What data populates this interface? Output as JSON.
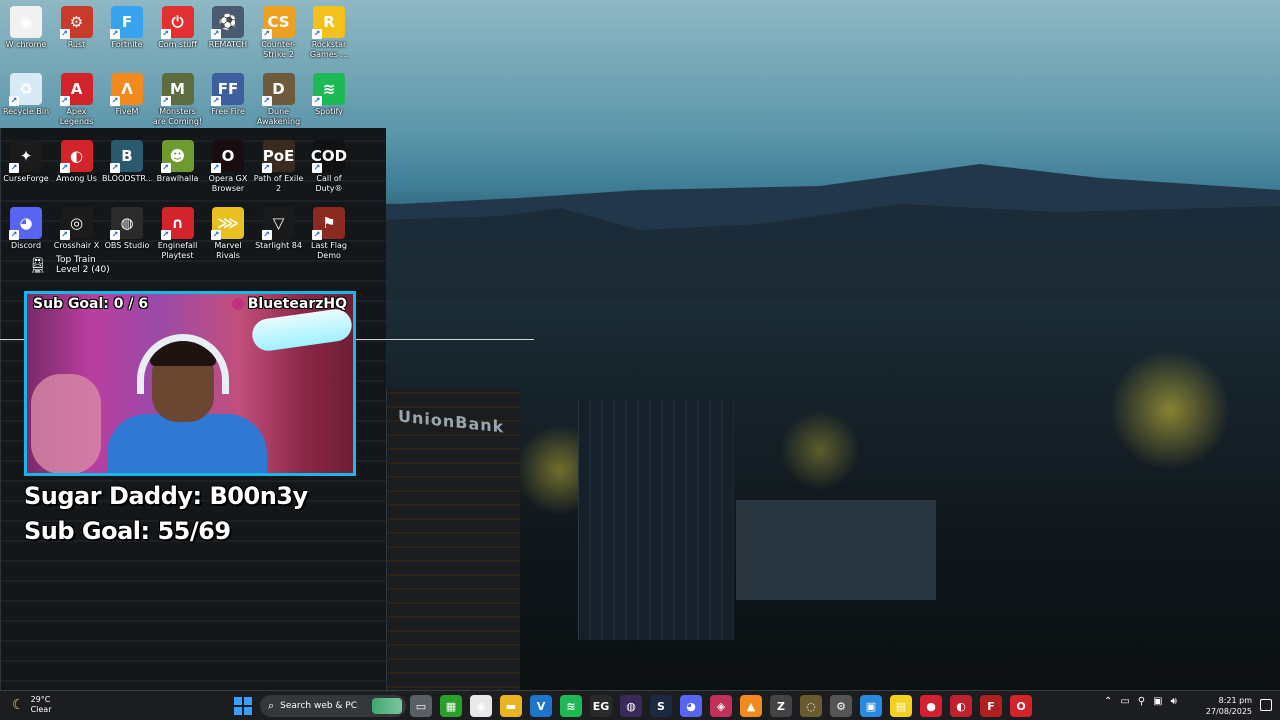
{
  "desktop": {
    "icons": [
      {
        "label": "W chrome",
        "icon": "chrome-icon",
        "color": "#f1f1f1",
        "glyph": "◉"
      },
      {
        "label": "Rust",
        "icon": "rust-icon",
        "color": "#c83b2a",
        "glyph": "⚙"
      },
      {
        "label": "Fortnite",
        "icon": "fortnite-icon",
        "color": "#38a4f0",
        "glyph": "F"
      },
      {
        "label": "Com stuff",
        "icon": "power-icon",
        "color": "#e23030",
        "glyph": "⏻"
      },
      {
        "label": "REMATCH",
        "icon": "rematch-icon",
        "color": "#4a5a70",
        "glyph": "⚽"
      },
      {
        "label": "Counter-Strike 2",
        "icon": "counter-strike-icon",
        "color": "#f0a020",
        "glyph": "CS"
      },
      {
        "label": "Rockstar Games ...",
        "icon": "rockstar-icon",
        "color": "#f4c01a",
        "glyph": "R"
      },
      {
        "label": "Recycle Bin",
        "icon": "recycle-bin-icon",
        "color": "#d9eaf7",
        "glyph": "♻"
      },
      {
        "label": "Apex Legends",
        "icon": "apex-legends-icon",
        "color": "#d3242b",
        "glyph": "A"
      },
      {
        "label": "FiveM",
        "icon": "fivem-icon",
        "color": "#f38a1e",
        "glyph": "Λ"
      },
      {
        "label": "Monsters are Coming! R...",
        "icon": "monsters-icon",
        "color": "#5d6d3f",
        "glyph": "M"
      },
      {
        "label": "Free Fire",
        "icon": "free-fire-icon",
        "color": "#3d5fa0",
        "glyph": "FF"
      },
      {
        "label": "Dune Awakening",
        "icon": "dune-icon",
        "color": "#6e5a3c",
        "glyph": "D"
      },
      {
        "label": "Spotify",
        "icon": "spotify-icon",
        "color": "#1db954",
        "glyph": "≋"
      },
      {
        "label": "CurseForge",
        "icon": "curseforge-icon",
        "color": "#1b1b1b",
        "glyph": "✦"
      },
      {
        "label": "Among Us",
        "icon": "among-us-icon",
        "color": "#d3242b",
        "glyph": "◐"
      },
      {
        "label": "BLOODSTR...",
        "icon": "bloodstrike-icon",
        "color": "#2b5a6e",
        "glyph": "B"
      },
      {
        "label": "Brawlhalla",
        "icon": "brawlhalla-icon",
        "color": "#6e9a30",
        "glyph": "☻"
      },
      {
        "label": "Opera GX Browser",
        "icon": "opera-gx-icon",
        "color": "#1a0d10",
        "glyph": "O"
      },
      {
        "label": "Path of Exile 2",
        "icon": "path-of-exile-icon",
        "color": "#3a2a20",
        "glyph": "PoE"
      },
      {
        "label": "Call of Duty®",
        "icon": "call-of-duty-icon",
        "color": "#111111",
        "glyph": "COD"
      },
      {
        "label": "Discord",
        "icon": "discord-icon",
        "color": "#5865f2",
        "glyph": "◕"
      },
      {
        "label": "Crosshair X",
        "icon": "crosshair-icon",
        "color": "#1b1b1b",
        "glyph": "◎"
      },
      {
        "label": "OBS Studio",
        "icon": "obs-icon",
        "color": "#2b2b2b",
        "glyph": "◍"
      },
      {
        "label": "Enginefall Playtest",
        "icon": "enginefall-icon",
        "color": "#d3242b",
        "glyph": "∩"
      },
      {
        "label": "Marvel Rivals",
        "icon": "marvel-rivals-icon",
        "color": "#e8c020",
        "glyph": "⋙"
      },
      {
        "label": "Starlight 84",
        "icon": "starlight-icon",
        "color": "#1a1a1a",
        "glyph": "▽"
      },
      {
        "label": "Last Flag Demo",
        "icon": "last-flag-icon",
        "color": "#8a2a20",
        "glyph": "⚑"
      }
    ]
  },
  "widget": {
    "top_train_title": "Top Train",
    "top_train_level": "Level 2  (40)"
  },
  "stream": {
    "cam_goal": "Sub Goal:  0 / 6",
    "cam_handle": "BluetearzHQ",
    "overlay_line1": "Sugar Daddy: B00n3y",
    "overlay_line2": "Sub Goal: 55/69"
  },
  "wallpaper": {
    "building_sign": "UnionBank"
  },
  "taskbar": {
    "weather_temp": "29°C",
    "weather_desc": "Clear",
    "search_placeholder": "Search web & PC",
    "apps": [
      {
        "icon": "file-explorer-icon",
        "color": "#5a5f66",
        "glyph": "▭"
      },
      {
        "icon": "xbox-app-icon",
        "color": "#2aa02a",
        "glyph": "▦"
      },
      {
        "icon": "chrome-taskbar-icon",
        "color": "#e8e8e8",
        "glyph": "◉"
      },
      {
        "icon": "folder-icon",
        "color": "#e8b422",
        "glyph": "▬"
      },
      {
        "icon": "vscode-icon",
        "color": "#1d74c9",
        "glyph": "V"
      },
      {
        "icon": "spotify-taskbar-icon",
        "color": "#1db954",
        "glyph": "≋"
      },
      {
        "icon": "epic-games-icon",
        "color": "#2a2a2a",
        "glyph": "EG"
      },
      {
        "icon": "obs-taskbar-icon",
        "color": "#3a2a5a",
        "glyph": "◍"
      },
      {
        "icon": "steam-icon",
        "color": "#1b2a40",
        "glyph": "S"
      },
      {
        "icon": "discord-taskbar-icon",
        "color": "#5865f2",
        "glyph": "◕"
      },
      {
        "icon": "app-icon",
        "color": "#c0305a",
        "glyph": "◈"
      },
      {
        "icon": "vlc-icon",
        "color": "#f08a1e",
        "glyph": "▲"
      },
      {
        "icon": "overlay-icon",
        "color": "#444444",
        "glyph": "Z"
      },
      {
        "icon": "cs-taskbar-icon",
        "color": "#6a5a30",
        "glyph": "◌"
      },
      {
        "icon": "settings-icon",
        "color": "#555555",
        "glyph": "⚙"
      },
      {
        "icon": "photos-icon",
        "color": "#2a8ae0",
        "glyph": "▣"
      },
      {
        "icon": "sticky-notes-icon",
        "color": "#f4d020",
        "glyph": "▤"
      },
      {
        "icon": "record-icon",
        "color": "#d32030",
        "glyph": "●"
      },
      {
        "icon": "media-icon",
        "color": "#c02030",
        "glyph": "◐"
      },
      {
        "icon": "fortnite-taskbar-icon",
        "color": "#b02020",
        "glyph": "F"
      },
      {
        "icon": "opera-taskbar-icon",
        "color": "#d3242b",
        "glyph": "O"
      }
    ],
    "time": "8:21 pm",
    "date": "27/08/2025"
  }
}
